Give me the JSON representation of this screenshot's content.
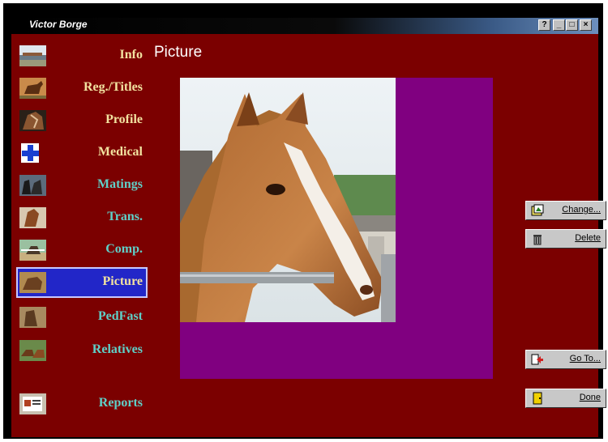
{
  "window": {
    "title": "Victor Borge",
    "controls": [
      "?",
      "_",
      "□",
      "×"
    ]
  },
  "page": {
    "title": "Picture"
  },
  "sidebar": {
    "items": [
      {
        "label": "Info",
        "color": "#f2e2a0",
        "icon": "barn-photo-icon"
      },
      {
        "label": "Reg./Titles",
        "color": "#f2e2a0",
        "icon": "horse-photo-icon"
      },
      {
        "label": "Profile",
        "color": "#f2e2a0",
        "icon": "horse-head-photo-icon"
      },
      {
        "label": "Medical",
        "color": "#f2e2a0",
        "icon": "medical-cross-icon"
      },
      {
        "label": "Matings",
        "color": "#5fd0c8",
        "icon": "horses-mating-photo-icon"
      },
      {
        "label": "Trans.",
        "color": "#5fd0c8",
        "icon": "horse-trans-photo-icon"
      },
      {
        "label": "Comp.",
        "color": "#5fd0c8",
        "icon": "competition-photo-icon"
      },
      {
        "label": "Picture",
        "color": "#f2e2a0",
        "icon": "picture-photo-icon"
      },
      {
        "label": "PedFast",
        "color": "#5fd0c8",
        "icon": "pedfast-photo-icon"
      },
      {
        "label": "Relatives",
        "color": "#5fd0c8",
        "icon": "relatives-photo-icon"
      },
      {
        "label": "Reports",
        "color": "#5fd0c8",
        "icon": "reports-photo-icon"
      }
    ]
  },
  "buttons": {
    "change": "Change...",
    "delete": "Delete",
    "goto": "Go To...",
    "done": "Done"
  },
  "colors": {
    "client_bg": "#7b0000",
    "photo_panel": "#800080",
    "active_item": "#2226c8"
  }
}
